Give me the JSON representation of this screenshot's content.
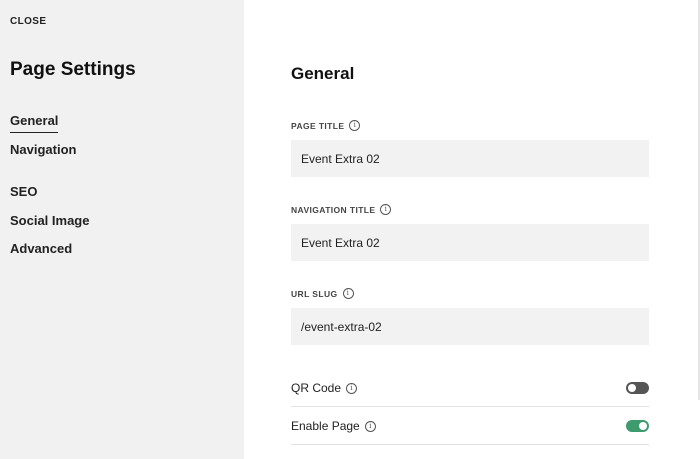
{
  "sidebar": {
    "close_label": "CLOSE",
    "title": "Page Settings",
    "items": [
      {
        "label": "General",
        "active": true
      },
      {
        "label": "Navigation"
      },
      {
        "label": "SEO"
      },
      {
        "label": "Social Image"
      },
      {
        "label": "Advanced"
      }
    ]
  },
  "main": {
    "section_title": "General",
    "fields": {
      "page_title": {
        "label": "PAGE TITLE",
        "value": "Event Extra 02"
      },
      "navigation_title": {
        "label": "NAVIGATION TITLE",
        "value": "Event Extra 02"
      },
      "url_slug": {
        "label": "URL SLUG",
        "value": "/event-extra-02"
      }
    },
    "toggles": {
      "qr_code": {
        "label": "QR Code",
        "enabled": false
      },
      "enable_page": {
        "label": "Enable Page",
        "enabled": true
      }
    },
    "info_glyph": "i"
  },
  "colors": {
    "sidebar_bg": "#f1f1f1",
    "input_bg": "#f2f2f2",
    "toggle_on": "#3d9b6d",
    "toggle_off": "#555555"
  }
}
